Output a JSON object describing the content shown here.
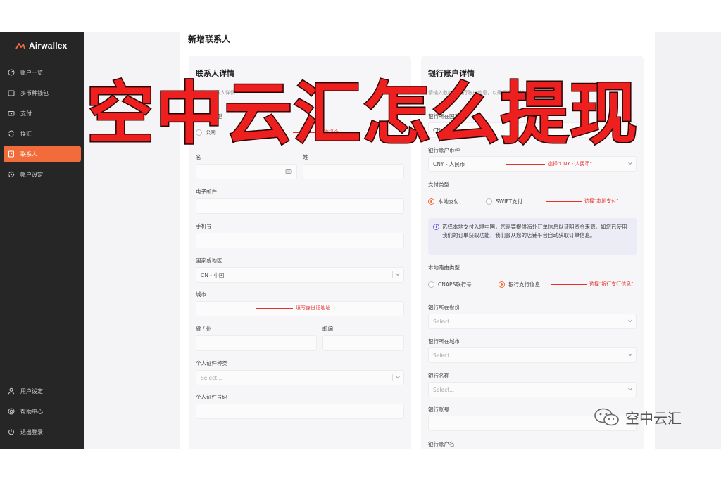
{
  "brand": {
    "name": "Airwallex"
  },
  "sidebar": {
    "items": [
      {
        "label": "账户一览",
        "icon": "dashboard-icon"
      },
      {
        "label": "多币种钱包",
        "icon": "wallet-icon"
      },
      {
        "label": "支付",
        "icon": "payment-icon"
      },
      {
        "label": "换汇",
        "icon": "exchange-icon"
      },
      {
        "label": "联系人",
        "icon": "contacts-icon",
        "active": true
      },
      {
        "label": "帐户设定",
        "icon": "gear-icon"
      }
    ],
    "bottom_items": [
      {
        "label": "用户设定",
        "icon": "user-icon"
      },
      {
        "label": "帮助中心",
        "icon": "help-icon"
      },
      {
        "label": "退出登录",
        "icon": "logout-icon"
      }
    ]
  },
  "page": {
    "title": "新增联系人"
  },
  "contact": {
    "title": "联系人详情",
    "hint": "请输入联系人详情",
    "type_label": "联系人类型",
    "type_company": "公司",
    "type_personal": "个人",
    "first_name_label": "名",
    "last_name_label": "姓",
    "email_label": "电子邮件",
    "phone_label": "手机号",
    "country_label": "国家或地区",
    "country_value": "CN - 中国",
    "city_label": "城市",
    "province_label": "省 / 州",
    "postcode_label": "邮编",
    "id_type_label": "个人证件种类",
    "id_type_placeholder": "Select...",
    "id_number_label": "个人证件号码"
  },
  "bank": {
    "title": "银行账户详情",
    "hint": "请输入收款人银行账户信息，以确保准确付款",
    "country_label": "银行所在国家",
    "country_value": "CN - 中国",
    "currency_label": "银行账户币种",
    "currency_value": "CNY - 人民币",
    "method_label": "支付类型",
    "method_local": "本地支付",
    "method_swift": "SWIFT支付",
    "info_text": "选择本地支付入境中国，您需要提供海外订单信息以证明资金来源。如您已使用我们的订单获取功能，我们会从您的店铺平台自动获取订单信息。",
    "routing_label": "本地路由类型",
    "routing_cnaps": "CNAPS联行号",
    "routing_branch": "银行支行信息",
    "province_label": "银行所在省份",
    "city_label": "银行所在城市",
    "name_label": "银行名称",
    "select_placeholder": "Select...",
    "account_no_label": "银行账号",
    "account_name_label": "银行账户名"
  },
  "annotations": {
    "personal": "选择个人",
    "currency": "选择\"CNY - 人民币\"",
    "local": "选择\"本地支付\"",
    "address": "填写身份证地址",
    "branch": "选择\"银行支行信息\""
  },
  "overlay": {
    "title": "空中云汇怎么提现"
  },
  "watermark": {
    "text": "空中云汇"
  },
  "colors": {
    "accent": "#f26b3a",
    "sidebar": "#262626",
    "annotation": "#e8302a",
    "overlay": "#ee1f1f"
  }
}
